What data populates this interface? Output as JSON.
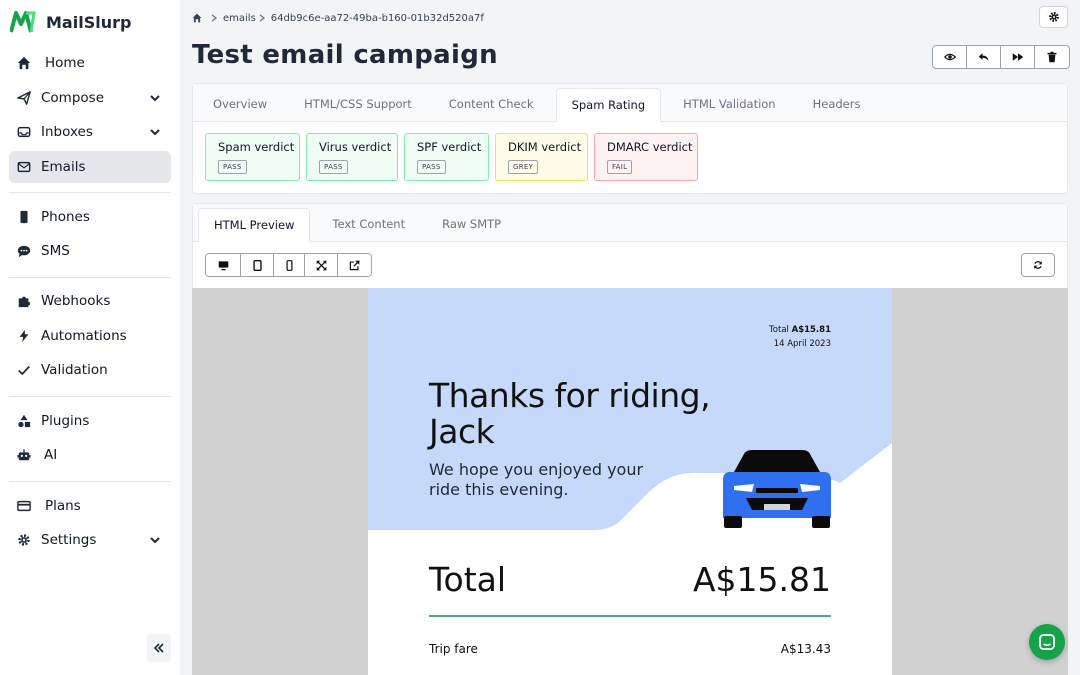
{
  "app": {
    "name": "MailSlurp"
  },
  "sidebar": {
    "items": [
      {
        "label": "Home",
        "icon": "home-icon"
      },
      {
        "label": "Compose",
        "icon": "paper-plane-icon"
      },
      {
        "label": "Inboxes",
        "icon": "inbox-icon"
      },
      {
        "label": "Emails",
        "icon": "envelope-icon"
      },
      {
        "label": "Phones",
        "icon": "phone-icon"
      },
      {
        "label": "SMS",
        "icon": "chat-icon"
      },
      {
        "label": "Webhooks",
        "icon": "puzzle-icon"
      },
      {
        "label": "Automations",
        "icon": "bolt-icon"
      },
      {
        "label": "Validation",
        "icon": "check-icon"
      },
      {
        "label": "Plugins",
        "icon": "shapes-icon"
      },
      {
        "label": "AI",
        "icon": "robot-icon"
      },
      {
        "label": "Plans",
        "icon": "credit-card-icon"
      },
      {
        "label": "Settings",
        "icon": "gear-icon"
      }
    ]
  },
  "breadcrumb": {
    "section": "emails",
    "id": "64db9c6e-aa72-49ba-b160-01b32d520a7f"
  },
  "page": {
    "title": "Test email campaign"
  },
  "analysis_tabs": [
    {
      "label": "Overview"
    },
    {
      "label": "HTML/CSS Support"
    },
    {
      "label": "Content Check"
    },
    {
      "label": "Spam Rating"
    },
    {
      "label": "HTML Validation"
    },
    {
      "label": "Headers"
    }
  ],
  "verdicts": [
    {
      "title": "Spam verdict",
      "status": "PASS"
    },
    {
      "title": "Virus verdict",
      "status": "PASS"
    },
    {
      "title": "SPF verdict",
      "status": "PASS"
    },
    {
      "title": "DKIM verdict",
      "status": "GREY"
    },
    {
      "title": "DMARC verdict",
      "status": "FAIL"
    }
  ],
  "content_tabs": [
    {
      "label": "HTML Preview"
    },
    {
      "label": "Text Content"
    },
    {
      "label": "Raw SMTP"
    }
  ],
  "email": {
    "total_prefix": "Total",
    "total_amount": "A$15.81",
    "date": "14 April 2023",
    "title_line1": "Thanks for riding,",
    "title_line2": "Jack",
    "subtitle_line1": "We hope you enjoyed your",
    "subtitle_line2": "ride this evening.",
    "total_label": "Total",
    "total_value": "A$15.81",
    "fare_label": "Trip fare",
    "fare_value": "A$13.43"
  },
  "colors": {
    "hero_bg": "#c6d9fb",
    "car": "#2f6ff0",
    "pass_bg": "#f0fdf4",
    "grey_bg": "#fefce8",
    "fail_bg": "#fef2f2",
    "chat": "#16a34a"
  }
}
